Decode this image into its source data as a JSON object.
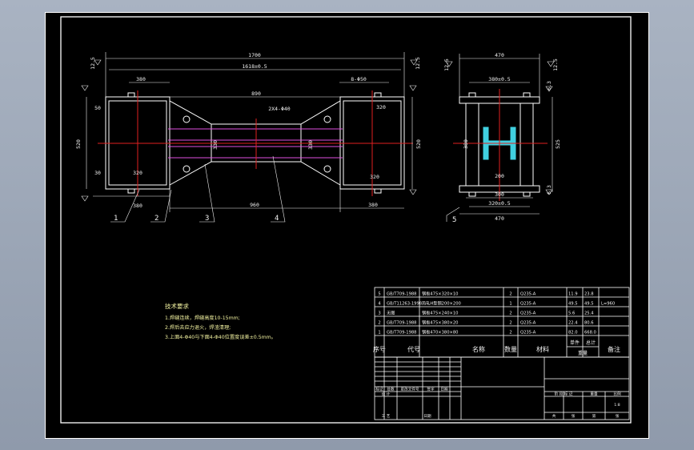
{
  "drawing": {
    "main_view": {
      "dims": {
        "overall_length": "1700",
        "inner_length": "1618±0.5",
        "left_top": "380",
        "right_top": "8-Φ50",
        "left_h": "520",
        "right_h": "520",
        "center_top": "890",
        "holes": "2X4-Φ40",
        "left_bottom": "380",
        "center_bottom": "960",
        "right_bottom": "380",
        "web_left": "330",
        "web_right": "330",
        "flange_left": "320",
        "flange_right": "320",
        "small_a": "50",
        "small_b": "30",
        "tol_left": "12.5",
        "tol_right": "12.5",
        "right_small": "320"
      },
      "part_numbers": [
        "1",
        "2",
        "3",
        "4"
      ]
    },
    "side_view": {
      "dims": {
        "top_width": "470",
        "inner_width": "380±0.5",
        "height": "525",
        "bottom_width": "300",
        "bottom_inner": "320±0.5",
        "bottom_total": "470",
        "mid": "200",
        "web_h": "380",
        "tol_a": "12.5",
        "tol_b": "6.3",
        "tol_c": "12.5",
        "tol_d": "6.3"
      },
      "part_number": "5"
    },
    "tech_notes": {
      "title": "技术要求",
      "lines": [
        "1.焊缝连续，焊缝高度10-15mm;",
        "2.焊后去应力退火，焊渣清理;",
        "3.上面4-Φ40与下面4-Φ40位置度误差±0.5mm。"
      ]
    }
  },
  "parts_table": {
    "headers": [
      "序号",
      "代号",
      "名称",
      "数量",
      "材料",
      "单件",
      "总计",
      "备注"
    ],
    "weight_label": "重量",
    "rows": [
      {
        "no": "5",
        "code": "GB/T709-1988",
        "name": "钢板475×320×10",
        "qty": "2",
        "material": "Q235-A",
        "unit": "11.9",
        "total": "23.8",
        "remark": ""
      },
      {
        "no": "4",
        "code": "GB/T11263-1998",
        "name": "热轧H型钢200×200",
        "qty": "1",
        "material": "Q235-A",
        "unit": "49.5",
        "total": "49.5",
        "remark": "L=960"
      },
      {
        "no": "3",
        "code": "无图",
        "name": "钢板475×240×10",
        "qty": "2",
        "material": "Q235-A",
        "unit": "5.6",
        "total": "25.4",
        "remark": ""
      },
      {
        "no": "2",
        "code": "GB/T709-1988",
        "name": "钢板475×380×20",
        "qty": "2",
        "material": "Q235-A",
        "unit": "22.4",
        "total": "80.6",
        "remark": ""
      },
      {
        "no": "1",
        "code": "GB/T709-1988",
        "name": "钢板470×380×80",
        "qty": "2",
        "material": "Q235-A",
        "unit": "82.0",
        "total": "668.0",
        "remark": ""
      }
    ]
  },
  "title_block": {
    "row_labels": [
      "标记",
      "处数",
      "更改文件号",
      "签字",
      "日期"
    ],
    "design": "设 计",
    "process": "工 艺",
    "date": "日期",
    "stage": "阶 段 标 记",
    "weight": "重量",
    "scale": "比例",
    "scale_value": "1:8",
    "sheet": "共",
    "sheet2": "张",
    "sheet3": "第",
    "sheet4": "张"
  },
  "colors": {
    "background": "#000000",
    "frame": "#ffffff",
    "dimension": "#f2f2f2",
    "centerline": "#e02020",
    "hidden": "#e050e0",
    "hatch": "#40d0e0",
    "note": "#f2f2a0"
  }
}
